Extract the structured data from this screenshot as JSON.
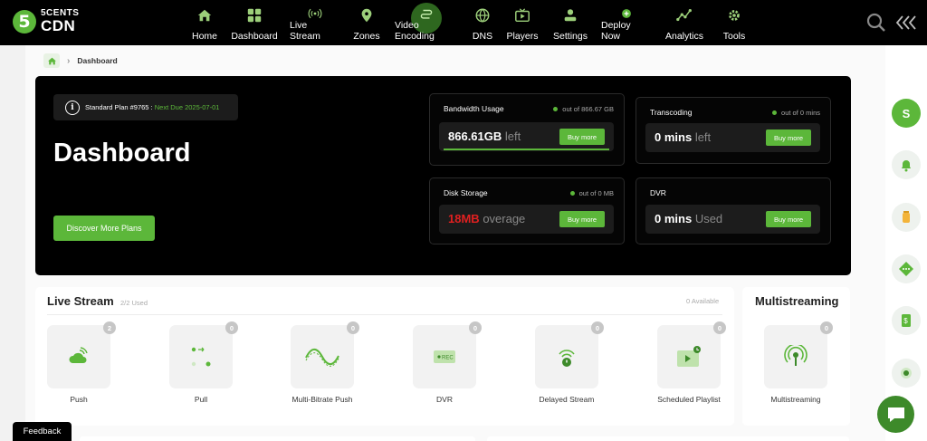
{
  "brand": {
    "badge": "5",
    "line1": "5CENTS",
    "line2": "CDN"
  },
  "nav": [
    {
      "label": "Home",
      "icon": "home-icon"
    },
    {
      "label": "Dashboard",
      "icon": "dashboard-grid-icon"
    },
    {
      "label": "Live Stream",
      "icon": "broadcast-icon"
    },
    {
      "label": "Zones",
      "icon": "location-pin-icon"
    },
    {
      "label": "Video Encoding",
      "icon": "encoding-icon",
      "active": true
    },
    {
      "label": "DNS",
      "icon": "globe-icon"
    },
    {
      "label": "Players",
      "icon": "tv-player-icon"
    },
    {
      "label": "Settings",
      "icon": "settings-user-icon"
    },
    {
      "label": "Deploy Now",
      "icon": "plus-circle-icon"
    },
    {
      "label": "Analytics",
      "icon": "analytics-line-icon"
    },
    {
      "label": "Tools",
      "icon": "tools-gear-icon"
    }
  ],
  "breadcrumb": {
    "current": "Dashboard"
  },
  "hero": {
    "plan_text": "Standard Plan #9765 : ",
    "plan_due": "Next Due 2025-07-01",
    "title": "Dashboard",
    "discover_label": "Discover More Plans"
  },
  "stats": {
    "bandwidth": {
      "title": "Bandwidth Usage",
      "meta": "out of 866.67 GB",
      "value": "866.61GB",
      "unit": "left",
      "button": "Buy more",
      "remaining_fraction": 0.9999
    },
    "transcoding": {
      "title": "Transcoding",
      "meta": "out of 0 mins",
      "value": "0 mins",
      "unit": "left",
      "button": "Buy more"
    },
    "disk": {
      "title": "Disk Storage",
      "meta": "out of 0 MB",
      "value": "18MB",
      "unit": "overage",
      "button": "Buy more"
    },
    "dvr": {
      "title": "DVR",
      "value": "0 mins",
      "unit": "Used",
      "button": "Buy more"
    }
  },
  "live_stream": {
    "title": "Live Stream",
    "used": "2/2 Used",
    "available": "0 Available",
    "tiles": [
      {
        "label": "Push",
        "count": "2",
        "icon": "push-cloud-icon"
      },
      {
        "label": "Pull",
        "count": "0",
        "icon": "pull-dots-icon"
      },
      {
        "label": "Multi-Bitrate Push",
        "count": "0",
        "icon": "multi-bitrate-wave-icon"
      },
      {
        "label": "DVR",
        "count": "0",
        "icon": "dvr-rec-icon"
      },
      {
        "label": "Delayed Stream",
        "count": "0",
        "icon": "delayed-stream-icon"
      },
      {
        "label": "Scheduled Playlist",
        "count": "0",
        "icon": "scheduled-playlist-icon"
      }
    ]
  },
  "multistreaming": {
    "title": "Multistreaming",
    "tile": {
      "label": "Multistreaming",
      "count": "0",
      "icon": "multistream-antenna-icon"
    }
  },
  "rail": {
    "avatar": "S"
  },
  "feedback_label": "Feedback",
  "colors": {
    "accent": "#5cb73a",
    "overage": "#e02020",
    "hero_bg": "#000000"
  }
}
